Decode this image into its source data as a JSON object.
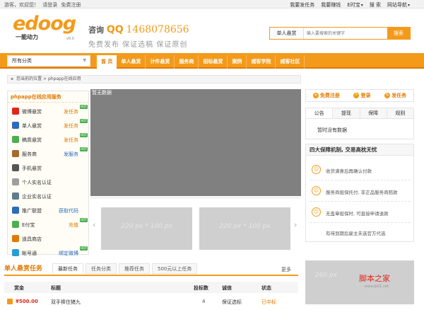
{
  "topbar": {
    "greeting": "游客，欢迎您！",
    "login": "请登录",
    "register": "免费注册",
    "links": [
      "我要发任务",
      "我要赚钱",
      "E时宝",
      "搜 索",
      "网站导航"
    ]
  },
  "logo": {
    "word": "edoog",
    "subtitle": "一能动力",
    "mark": "v6.0"
  },
  "slogan": {
    "qq_prefix": "咨询",
    "qq_label": "QQ",
    "qq_number": "1468078656",
    "tagline": "免费发布  保证选稿  保证原创"
  },
  "search": {
    "category": "单人悬赏",
    "placeholder": "输入要搜索的关键字",
    "button": "搜索"
  },
  "nav": {
    "all_categories": "所有分类",
    "items": [
      "首 页",
      "单人悬赏",
      "计件悬赏",
      "服务商",
      "招标悬赏",
      "案例",
      "威客学院",
      "威客社区"
    ]
  },
  "breadcrumb": {
    "prefix": "您当前的位置",
    "page": "phpapp在线应用"
  },
  "sidebar": {
    "title": "phpapp在线应用服务",
    "items": [
      {
        "label": "微博悬赏",
        "action": "发任务",
        "color": "#e0261a",
        "hot": "HOT"
      },
      {
        "label": "单人悬赏",
        "action": "发任务",
        "color": "#2b6dbc",
        "hot": "HOT"
      },
      {
        "label": "稿质悬赏",
        "action": "发任务",
        "color": "#4caf50",
        "hot": "HOT"
      },
      {
        "label": "服务商",
        "action": "发服务",
        "color": "#a66a2c",
        "hot": "HOT"
      },
      {
        "label": "手机悬赏",
        "action": "",
        "color": "#555555",
        "hot": ""
      },
      {
        "label": "个人实名认证",
        "action": "",
        "color": "#9e9e9e",
        "hot": ""
      },
      {
        "label": "企业实名认证",
        "action": "",
        "color": "#607d8b",
        "hot": ""
      },
      {
        "label": "推广联盟",
        "action": "获取代码",
        "color": "#2b6dbc",
        "hot": ""
      },
      {
        "label": "E付宝",
        "action": "充值",
        "color": "#4caf50",
        "hot": "HOT"
      },
      {
        "label": "道具商店",
        "action": "",
        "color": "#e07a00",
        "hot": ""
      },
      {
        "label": "帐号通",
        "action": "绑定微博",
        "color": "#2b9bd6",
        "hot": "HOT"
      }
    ]
  },
  "banner": {
    "label": "暂无数据"
  },
  "thumbs": {
    "placeholder_1": "220 px * 100 px",
    "placeholder_2": "220 px * 100 px"
  },
  "quick_actions": [
    "免费注册",
    "登录",
    "发任务"
  ],
  "notice_tabs": {
    "tabs": [
      "公告",
      "提现",
      "保障",
      "规则"
    ],
    "empty": "暂时没有数据"
  },
  "guarantee": {
    "title": "四大保障机制, 交易高枕无忧",
    "items": [
      "收货满意后再确认付款",
      "服务商担保托付, 非正品服务商赔款",
      "无盖章担保时, 可直接申请退款",
      "有待到期后雇主未选官方代选"
    ]
  },
  "tasks": {
    "title": "单人悬赏任务",
    "tabs": [
      "最新任务",
      "任务分类",
      "推荐任务",
      "500元以上任务"
    ],
    "more": "更多",
    "columns": [
      "赏金",
      "标题",
      "投标数",
      "诚信",
      "状态"
    ],
    "rows": [
      {
        "money": "¥500.00",
        "title": "双手捧住猪九",
        "count": "4",
        "credit": "保证选标",
        "status": "已中标"
      }
    ]
  },
  "ad": {
    "placeholder": "260 px",
    "watermark": "脚本之家",
    "url": "www.jb51.net"
  }
}
